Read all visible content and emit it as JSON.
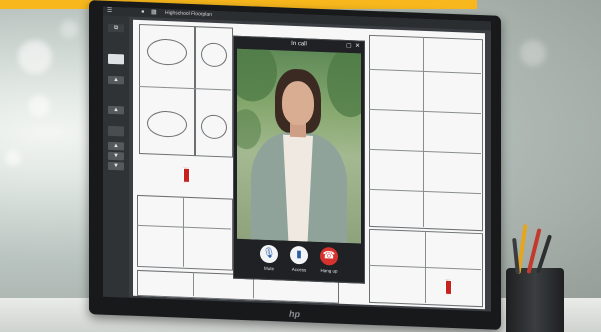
{
  "app": {
    "window_title": "Highschool Floorplan"
  },
  "left_rail": {
    "buttons": [
      "▲",
      "▲",
      "▲",
      "▼",
      "▼"
    ]
  },
  "call": {
    "title": "In call",
    "actions": [
      {
        "label": "Mute",
        "icon": "microphone-icon"
      },
      {
        "label": "Access",
        "icon": "door-icon"
      },
      {
        "label": "Hang up",
        "icon": "phone-hangup-icon"
      }
    ]
  },
  "colors": {
    "banner": "#f7b71d",
    "hangup": "#d6322e",
    "door_tag": "#c8221f"
  }
}
